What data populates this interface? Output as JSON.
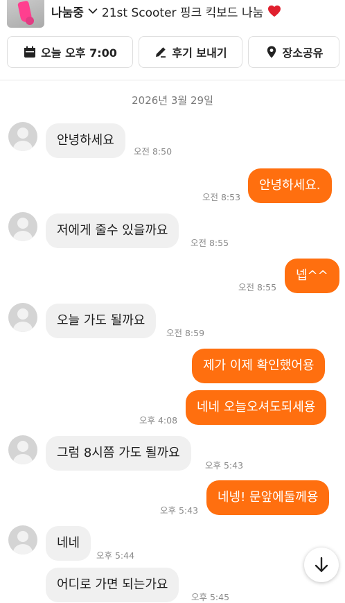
{
  "header": {
    "status": "나눔중",
    "item_title": "21st Scooter 핑크 킥보드 나눔",
    "actions": [
      {
        "label": "오늘 오후 7:00",
        "icon": "calendar-icon"
      },
      {
        "label": "후기 보내기",
        "icon": "pencil-icon"
      },
      {
        "label": "장소공유",
        "icon": "location-pin-icon"
      }
    ]
  },
  "chat": {
    "date": "2026년 3월 29일",
    "messages": [
      {
        "side": "in",
        "text": "안녕하세요",
        "time": "오전 8:50"
      },
      {
        "side": "out",
        "text": "안녕하세요.",
        "time": "오전 8:53"
      },
      {
        "side": "in",
        "text": "저에게 줄수 있을까요",
        "time": "오전 8:55"
      },
      {
        "side": "out",
        "text": "넵^^",
        "time": "오전 8:55"
      },
      {
        "side": "in",
        "text": "오늘 가도 될까요",
        "time": "오전 8:59"
      },
      {
        "side": "out",
        "text": "제가 이제 확인했어용",
        "time": ""
      },
      {
        "side": "out",
        "text": "네네 오늘오셔도되세용",
        "time": "오후 4:08"
      },
      {
        "side": "in",
        "text": "그럼 8시쯤 가도 될까요",
        "time": "오후 5:43"
      },
      {
        "side": "out",
        "text": "네넹! 문앞에둘께용",
        "time": "오후 5:43"
      },
      {
        "side": "in",
        "text": "네네",
        "time": "오후 5:44"
      },
      {
        "side": "in",
        "text": "어디로 가면 되는가요",
        "time": "오후 5:45"
      }
    ]
  },
  "colors": {
    "accent": "#ff6f0f",
    "incoming_bubble": "#f0f0f0",
    "heart": "#e0202e"
  }
}
